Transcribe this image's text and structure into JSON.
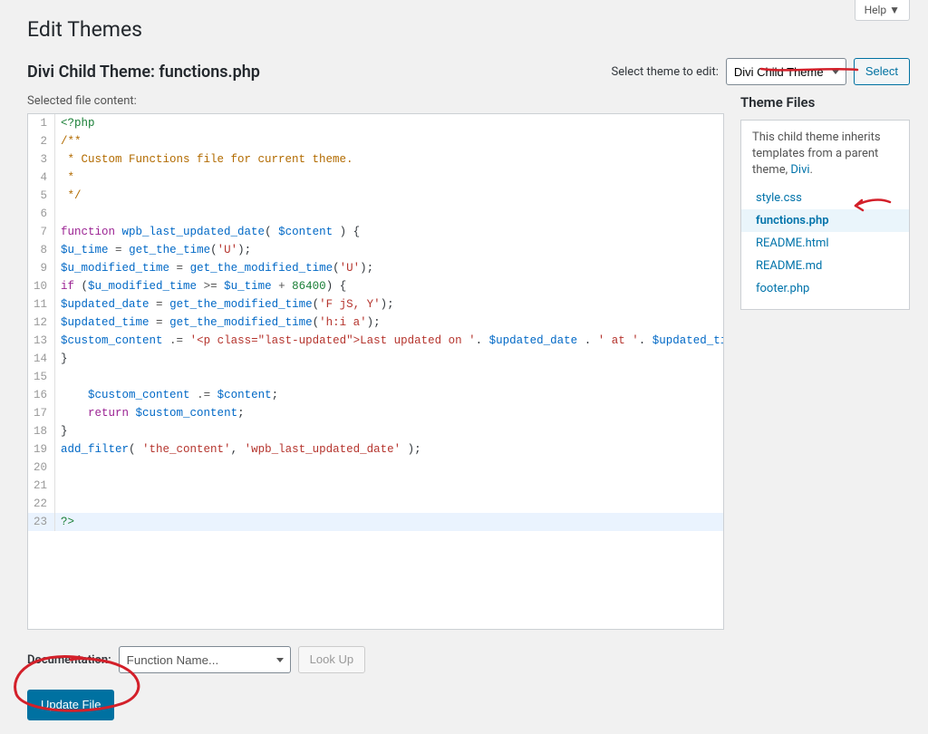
{
  "help_tab": "Help ▼",
  "page_title": "Edit Themes",
  "file_title": "Divi Child Theme: functions.php",
  "select_theme_label": "Select theme to edit:",
  "theme_select_value": "Divi Child Theme",
  "select_button": "Select",
  "selected_file_label": "Selected file content:",
  "sidebar": {
    "heading": "Theme Files",
    "inherit_text_prefix": "This child theme inherits templates from a parent theme, ",
    "parent_theme": "Divi",
    "files": [
      {
        "name": "style.css",
        "active": false
      },
      {
        "name": "functions.php",
        "active": true
      },
      {
        "name": "README.html",
        "active": false
      },
      {
        "name": "README.md",
        "active": false
      },
      {
        "name": "footer.php",
        "active": false
      }
    ]
  },
  "code_lines": [
    "[TAG]<?php[/TAG]",
    "[COMM]/**[/COMM]",
    "[COMM] * Custom Functions file for current theme.[/COMM]",
    "[COMM] *[/COMM]",
    "[COMM] */[/COMM]",
    "",
    "[KW]function[/KW] [FN]wpb_last_updated_date[/FN]( [VAR]$content[/VAR] ) {",
    "[VAR]$u_time[/VAR] [OP]=[/OP] [FN]get_the_time[/FN]([STR]'U'[/STR]);",
    "[VAR]$u_modified_time[/VAR] [OP]=[/OP] [FN]get_the_modified_time[/FN]([STR]'U'[/STR]);",
    "[KW]if[/KW] ([VAR]$u_modified_time[/VAR] [OP]>=[/OP] [VAR]$u_time[/VAR] [OP]+[/OP] [NUM]86400[/NUM]) {",
    "[VAR]$updated_date[/VAR] [OP]=[/OP] [FN]get_the_modified_time[/FN]([STR]'F jS, Y'[/STR]);",
    "[VAR]$updated_time[/VAR] [OP]=[/OP] [FN]get_the_modified_time[/FN]([STR]'h:i a'[/STR]);",
    "[VAR]$custom_content[/VAR] [OP].=[/OP] [STR]'<p class=\"last-updated\">Last updated on '[/STR]. [VAR]$updated_date[/VAR] . [STR]' at '[/STR]. [VAR]$updated_time[/VAR] .[STR]'</p>'[/STR];",
    "}",
    "",
    "    [VAR]$custom_content[/VAR] [OP].=[/OP] [VAR]$content[/VAR];",
    "    [KW]return[/KW] [VAR]$custom_content[/VAR];",
    "}",
    "[FN]add_filter[/FN]( [STR]'the_content'[/STR], [STR]'wpb_last_updated_date'[/STR] );",
    "",
    "",
    "",
    "[TAG]?>[/TAG]"
  ],
  "active_line": 23,
  "documentation": {
    "label": "Documentation:",
    "placeholder": "Function Name...",
    "lookup_button": "Look Up"
  },
  "update_button": "Update File"
}
